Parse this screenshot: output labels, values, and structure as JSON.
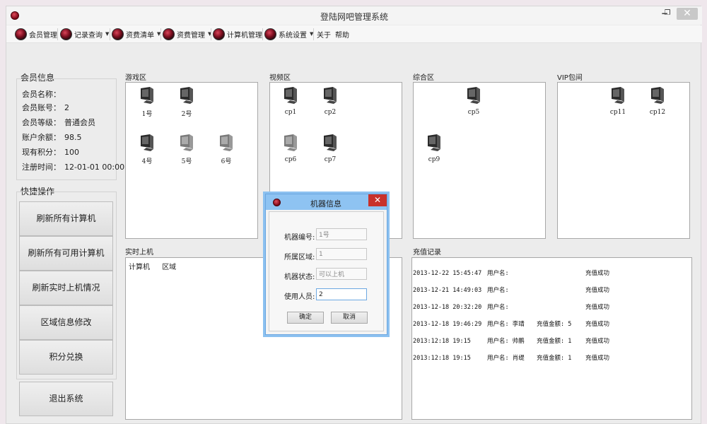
{
  "window": {
    "title": "登陆网吧管理系统",
    "minimize": "−",
    "maximize": "❐",
    "close": "✕"
  },
  "menu": [
    {
      "label": "会员管理",
      "icon": "red-ball-icon",
      "dropdown": false
    },
    {
      "label": "记录查询",
      "icon": "red-ball-icon",
      "dropdown": true
    },
    {
      "label": "资费清单",
      "icon": "red-ball-icon",
      "dropdown": true
    },
    {
      "label": "资费管理",
      "icon": "red-ball-icon",
      "dropdown": true
    },
    {
      "label": "计算机管理",
      "icon": "red-ball-icon",
      "dropdown": false
    },
    {
      "label": "系统设置",
      "icon": "red-ball-icon",
      "dropdown": true
    },
    {
      "label": "关于"
    },
    {
      "label": "帮助"
    }
  ],
  "member_info": {
    "title": "会员信息",
    "rows": [
      {
        "label": "会员名称：",
        "value": ""
      },
      {
        "label": "会员账号：",
        "value": "2"
      },
      {
        "label": "会员等级：",
        "value": "普通会员"
      },
      {
        "label": "账户余额：",
        "value": "98.5"
      },
      {
        "label": "现有积分：",
        "value": "100"
      },
      {
        "label": "注册时间：",
        "value": "12-01-01 00:00"
      }
    ]
  },
  "quick_ops": {
    "title": "快捷操作",
    "buttons": [
      "刷新所有计算机",
      "刷新所有可用计算机",
      "刷新实时上机情况",
      "区域信息修改",
      "积分兑换"
    ]
  },
  "exit_button": "退出系统",
  "zones": [
    {
      "title": "游戏区",
      "computers": [
        {
          "name": "1号",
          "state": "in-use"
        },
        {
          "name": "2号",
          "state": "in-use"
        },
        {
          "name": "4号",
          "state": "in-use"
        },
        {
          "name": "5号",
          "state": "idle"
        },
        {
          "name": "6号",
          "state": "idle"
        }
      ]
    },
    {
      "title": "视频区",
      "computers": [
        {
          "name": "cp1",
          "state": "in-use"
        },
        {
          "name": "cp2",
          "state": "in-use"
        },
        {
          "name": "cp6",
          "state": "idle"
        },
        {
          "name": "cp7",
          "state": "in-use"
        }
      ]
    },
    {
      "title": "综合区",
      "computers": [
        {
          "name": "cp5",
          "state": "in-use"
        },
        {
          "name": "cp9",
          "state": "in-use"
        }
      ]
    },
    {
      "title": "VIP包间",
      "computers": [
        {
          "name": "cp11",
          "state": "in-use"
        },
        {
          "name": "cp12",
          "state": "in-use"
        }
      ]
    }
  ],
  "realtime": {
    "title": "实时上机",
    "columns": [
      "计算机",
      "区域"
    ]
  },
  "recharge": {
    "title": "充值记录",
    "rows": [
      {
        "time": "2013-12-22 15:45:47",
        "user": "用户名:",
        "amount": "",
        "status": "充值成功"
      },
      {
        "time": "2013-12-21 14:49:03",
        "user": "用户名:",
        "amount": "",
        "status": "充值成功"
      },
      {
        "time": "2013-12-18 20:32:20",
        "user": "用户名:",
        "amount": "",
        "status": "充值成功"
      },
      {
        "time": "2013-12-18 19:46:29",
        "user": "用户名: 李靖",
        "amount": "充值金额: 5",
        "status": "充值成功"
      },
      {
        "time": "2013:12:18 19:15",
        "user": "用户名: 帅鹏",
        "amount": "充值金额: 1",
        "status": "充值成功"
      },
      {
        "time": "2013:12:18 19:15",
        "user": "用户名: 肖缇",
        "amount": "充值金额: 1",
        "status": "充值成功"
      }
    ]
  },
  "dialog": {
    "title": "机器信息",
    "close": "✕",
    "fields": [
      {
        "label": "机器编号:",
        "value": "1号"
      },
      {
        "label": "所属区域:",
        "value": "1"
      },
      {
        "label": "机器状态:",
        "value": "可以上机"
      },
      {
        "label": "使用人员:",
        "value": "2"
      }
    ],
    "ok": "确定",
    "cancel": "取消"
  },
  "colors": {
    "dialog_title": "#8ec3f2",
    "close_red": "#c8312b",
    "monitor_dark": "#2b2b2b",
    "monitor_idle": "#7a7a7a"
  }
}
